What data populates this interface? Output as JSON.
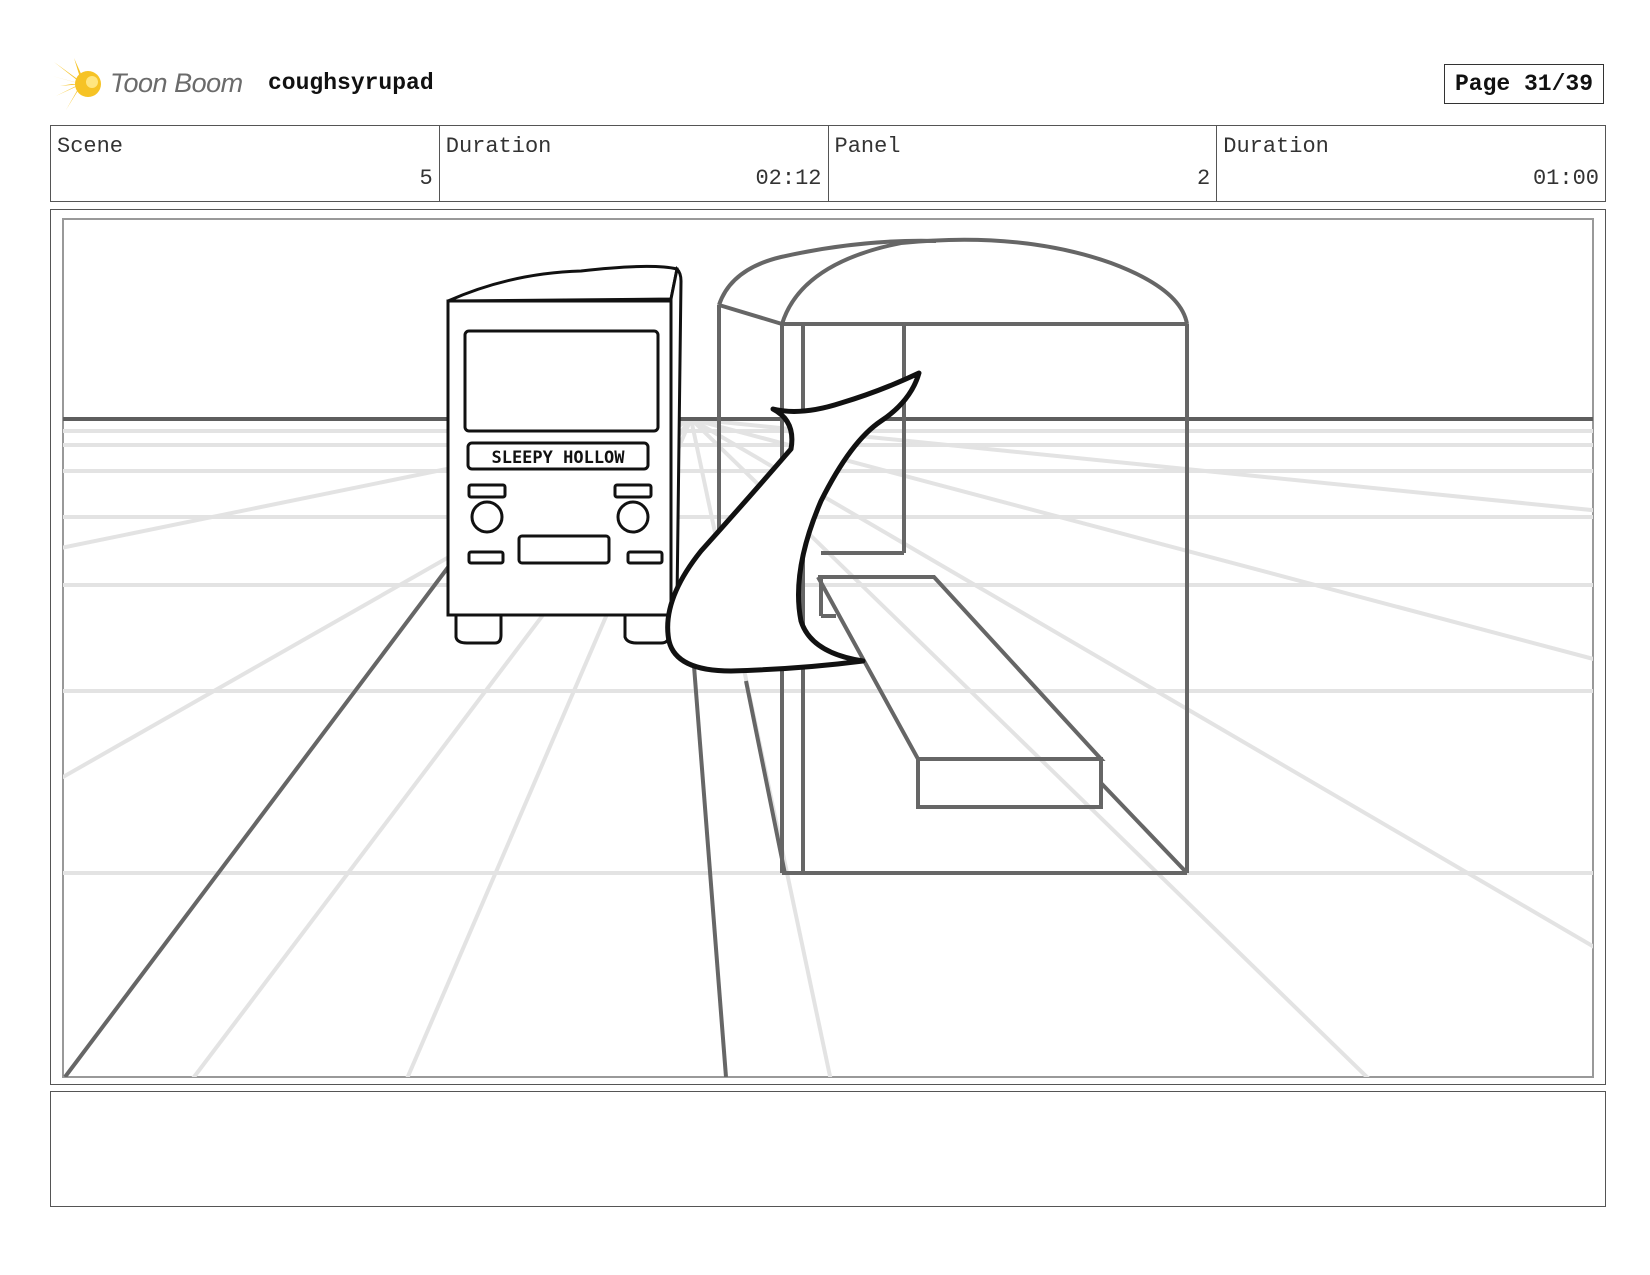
{
  "header": {
    "logo_text": "Toon Boom",
    "project_name": "coughsyrupad",
    "page_label": "Page 31/39"
  },
  "info": {
    "scene_label": "Scene",
    "scene_value": "5",
    "scene_duration_label": "Duration",
    "scene_duration_value": "02:12",
    "panel_label": "Panel",
    "panel_value": "2",
    "panel_duration_label": "Duration",
    "panel_duration_value": "01:00"
  },
  "panel": {
    "bus_sign": "SLEEPY HOLLOW"
  },
  "notes": {
    "text": ""
  }
}
